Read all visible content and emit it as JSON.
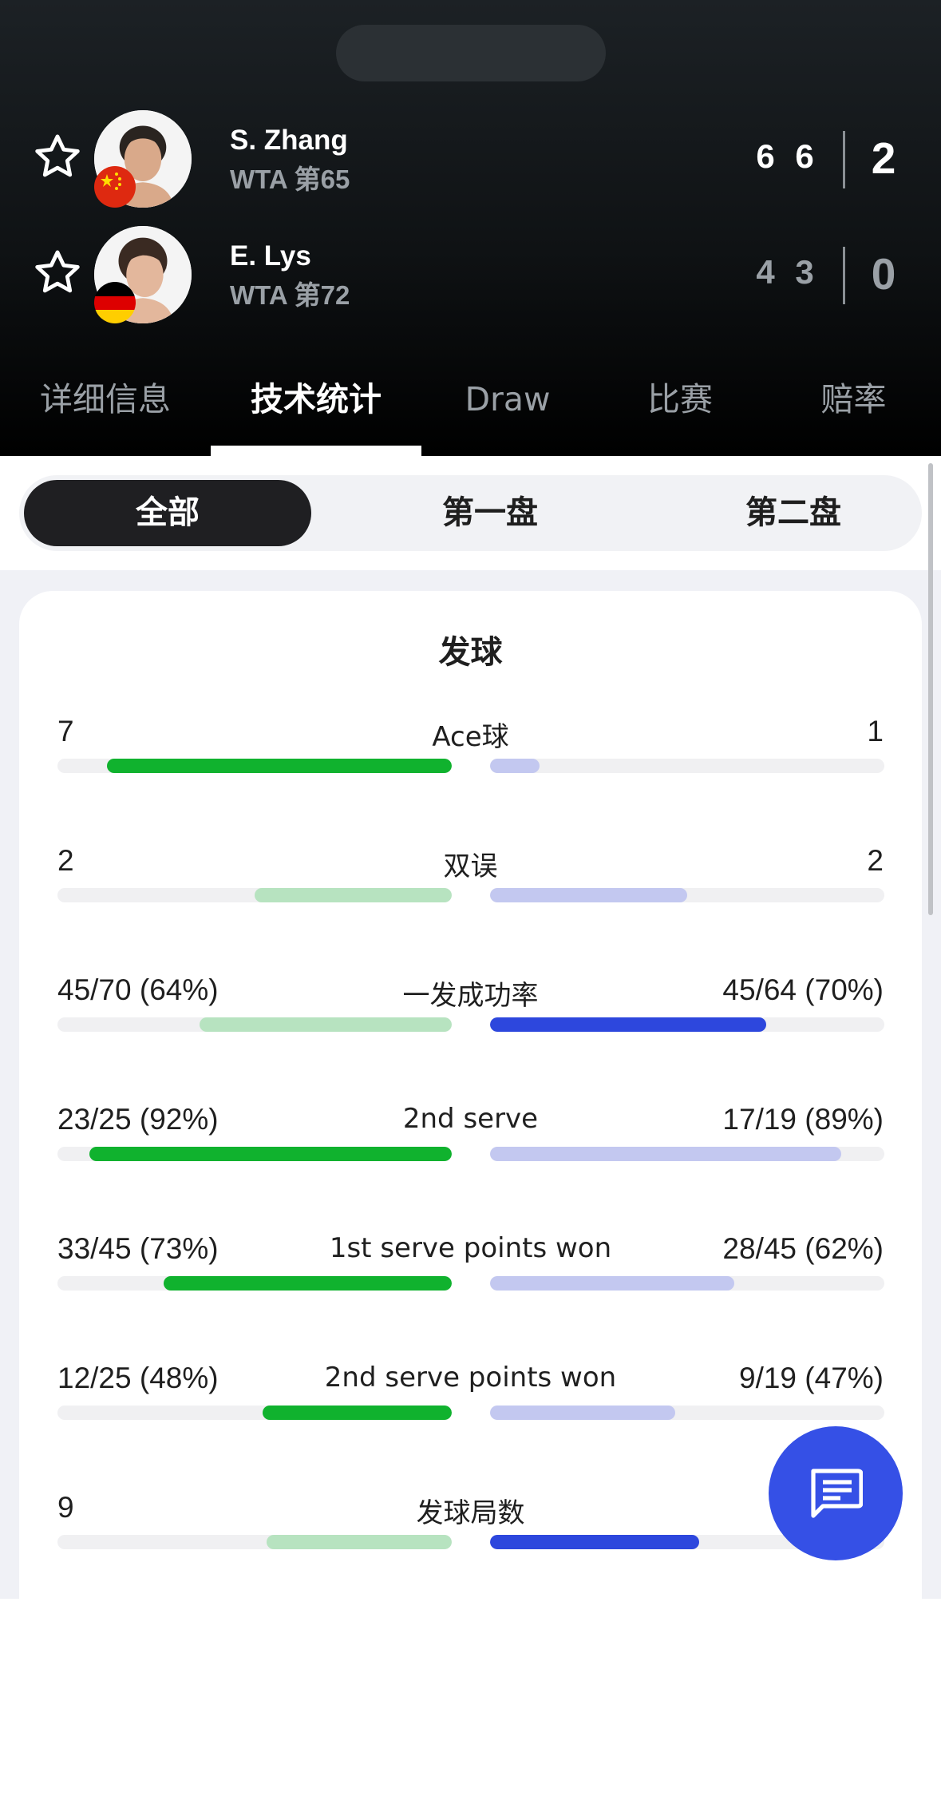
{
  "colors": {
    "header_bg": "#0f1214",
    "accent_green": "#10b22e",
    "accent_green_light": "#b7e3c0",
    "accent_blue": "#2d47dd",
    "accent_blue_light": "#c3c8f0",
    "fab": "#3550e6"
  },
  "players": [
    {
      "name": "S. Zhang",
      "rank": "WTA 第65",
      "flag": "china-flag-icon",
      "sets": [
        "6",
        "6"
      ],
      "match": "2"
    },
    {
      "name": "E. Lys",
      "rank": "WTA 第72",
      "flag": "germany-flag-icon",
      "sets": [
        "4",
        "3"
      ],
      "match": "0"
    }
  ],
  "tabs": [
    {
      "label": "详细信息"
    },
    {
      "label": "技术统计",
      "active": true
    },
    {
      "label": "Draw"
    },
    {
      "label": "比赛"
    },
    {
      "label": "赔率"
    }
  ],
  "segments": [
    {
      "label": "全部",
      "active": true
    },
    {
      "label": "第一盘"
    },
    {
      "label": "第二盘"
    }
  ],
  "section_title": "发球",
  "stats": [
    {
      "label": "Ace球",
      "left": "7",
      "right": "1",
      "left_ratio": 0.875,
      "right_ratio": 0.125,
      "left_style": "g-strong",
      "right_style": "b-light"
    },
    {
      "label": "双误",
      "left": "2",
      "right": "2",
      "left_ratio": 0.5,
      "right_ratio": 0.5,
      "left_style": "g-light",
      "right_style": "b-light"
    },
    {
      "label": "一发成功率",
      "left": "45/70 (64%)",
      "right": "45/64 (70%)",
      "left_ratio": 0.64,
      "right_ratio": 0.7,
      "left_style": "g-light",
      "right_style": "b-strong"
    },
    {
      "label": "2nd serve",
      "left": "23/25 (92%)",
      "right": "17/19 (89%)",
      "left_ratio": 0.92,
      "right_ratio": 0.89,
      "left_style": "g-strong",
      "right_style": "b-light"
    },
    {
      "label": "1st serve points won",
      "left": "33/45 (73%)",
      "right": "28/45 (62%)",
      "left_ratio": 0.73,
      "right_ratio": 0.62,
      "left_style": "g-strong",
      "right_style": "b-light"
    },
    {
      "label": "2nd serve points won",
      "left": "12/25 (48%)",
      "right": "9/19 (47%)",
      "left_ratio": 0.48,
      "right_ratio": 0.47,
      "left_style": "g-strong",
      "right_style": "b-light"
    },
    {
      "label": "发球局数",
      "left": "9",
      "right": "",
      "left_ratio": 0.47,
      "right_ratio": 0.53,
      "left_style": "g-light",
      "right_style": "b-strong"
    }
  ],
  "fab": {
    "icon": "chat-icon"
  }
}
